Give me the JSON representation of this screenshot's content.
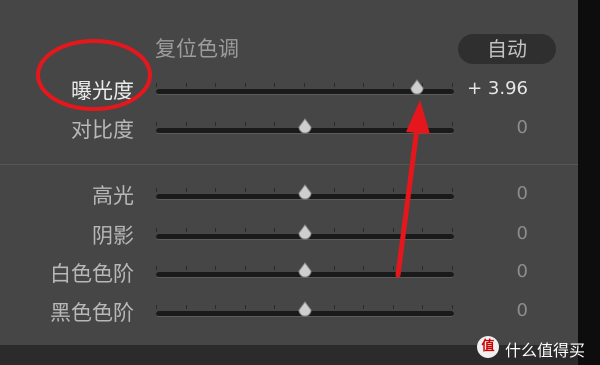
{
  "panel": {
    "reset_label": "复位色调",
    "auto_label": "自动"
  },
  "sliders": [
    {
      "label": "曝光度",
      "value": "+ 3.96",
      "level": 0.875,
      "active": true
    },
    {
      "label": "对比度",
      "value": "0",
      "level": 0.5,
      "active": false
    },
    {
      "label": "高光",
      "value": "0",
      "level": 0.5,
      "active": false
    },
    {
      "label": "阴影",
      "value": "0",
      "level": 0.5,
      "active": false
    },
    {
      "label": "白色色阶",
      "value": "0",
      "level": 0.5,
      "active": false
    },
    {
      "label": "黑色色阶",
      "value": "0",
      "level": 0.5,
      "active": false
    }
  ],
  "annotation": {
    "color": "#e5171c"
  },
  "watermark": {
    "badge": "值",
    "text": "什么值得买"
  },
  "colors": {
    "panel": "#464646",
    "track": "#1a1a1a",
    "annotation": "#e5171c"
  }
}
